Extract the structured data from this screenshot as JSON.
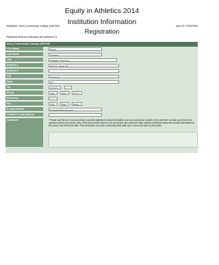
{
  "header": {
    "title_line1": "Equity in Athletics 2014",
    "title_line2": "Institution Information",
    "title_line3": "Registration",
    "institution": "Institution: Surry Community College (199768)",
    "user_id": "User ID: E1997681",
    "required_note": "*Required fields are indicated with asterisks (*)."
  },
  "form": {
    "section_title": "Surry Community College (199768)",
    "required_mark": "*",
    "first_name": {
      "label": "First Name",
      "value": "Mark"
    },
    "last_name": {
      "label": "Last Name",
      "value": "Tucker"
    },
    "title": {
      "label": "Title",
      "value": "Athletic Director"
    },
    "address1": {
      "label": "Address 1",
      "value": "630 S. Main St"
    },
    "address2": {
      "label": "Address 2",
      "value": ""
    },
    "city": {
      "label": "City",
      "value": "Dobson"
    },
    "state": {
      "label": "State",
      "value": "NC"
    },
    "zip": {
      "label": "Zip",
      "value": "27017",
      "ext": ""
    },
    "phone": {
      "label": "Phone",
      "area": "336",
      "prefix": "386",
      "line": "3217"
    },
    "extension": {
      "label": "Extension",
      "value": ""
    },
    "fax": {
      "label": "Fax",
      "area": "336",
      "prefix": "386",
      "line": "8951"
    },
    "email": {
      "label": "E-mail Address",
      "value": "tuckerm@surry.edu"
    },
    "confirm_email": {
      "label": "Confirm E-mail Address",
      "value": ""
    },
    "comment": {
      "label": "Comment",
      "instructions": "* Please use this box if you would like to provide additional contact information such as a cell phone number or the best time to reach you if there are questions about your survey. Also, if the person listed above is not the person who enters the data, please provide the name and contact information for the person who enters the data. This information is for the survey help desk staff only. It will not be seen by the public.",
      "value": ""
    }
  }
}
